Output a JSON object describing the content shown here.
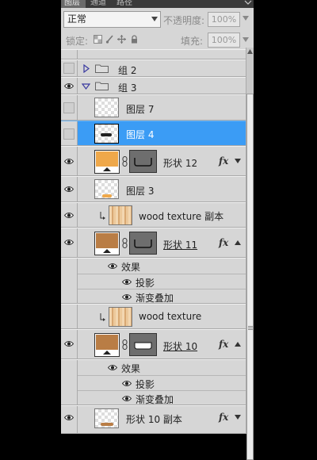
{
  "tabs": [
    "图层",
    "通道",
    "路径"
  ],
  "toolbar": {
    "blend_mode": "正常",
    "opacity_label": "不透明度:",
    "opacity_value": "100%",
    "lock_label": "锁定:",
    "fill_label": "填充:",
    "fill_value": "100%"
  },
  "layers": {
    "group_2": "组 2",
    "group_3": "组 3",
    "layer_7": "图层 7",
    "layer_4": "图层 4",
    "shape_12": "形状 12",
    "layer_3": "图层 3",
    "wood_copy": "wood texture 副本",
    "shape_11": "形状 11",
    "effects_1": "效果",
    "shadow_1": "投影",
    "gradient_1": "渐变叠加",
    "wood": "wood texture",
    "shape_10": "形状 10",
    "effects_2": "效果",
    "shadow_2": "投影",
    "gradient_2": "渐变叠加",
    "shape_10_copy": "形状 10 副本"
  },
  "fx_label": "fx",
  "colors": {
    "panel_bg": "#d6d6d6",
    "selected": "#3b9cf5",
    "orange_fill": "#efa84a",
    "brown_fill": "#b97d45"
  },
  "icons": [
    "eye-icon",
    "folder-icon",
    "link-icon",
    "fx-icon",
    "lock-icon",
    "move-icon",
    "brush-icon",
    "menu-icon"
  ]
}
